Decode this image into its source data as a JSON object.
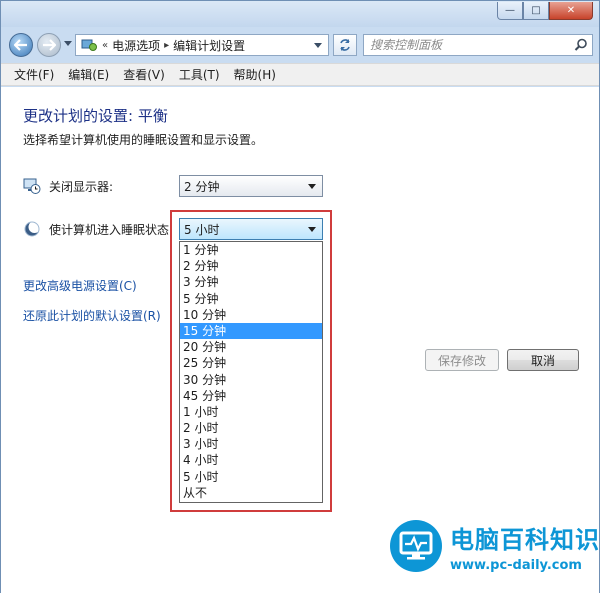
{
  "window": {
    "controls": {
      "minimize": "—",
      "maximize": "□",
      "close": "✕"
    }
  },
  "address_bar": {
    "chevron": "«",
    "breadcrumbs": [
      "电源选项",
      "编辑计划设置"
    ],
    "separator": "▸"
  },
  "search": {
    "placeholder": "搜索控制面板"
  },
  "menu": [
    "文件(F)",
    "编辑(E)",
    "查看(V)",
    "工具(T)",
    "帮助(H)"
  ],
  "page": {
    "title": "更改计划的设置: 平衡",
    "subtitle": "选择希望计算机使用的睡眠设置和显示设置。"
  },
  "settings": {
    "display_off": {
      "label": "关闭显示器:",
      "value": "2 分钟",
      "icon": "monitor-clock-icon"
    },
    "sleep": {
      "label": "使计算机进入睡眠状态:",
      "value": "5 小时",
      "icon": "moon-icon"
    }
  },
  "sleep_options": {
    "selected_index": 5,
    "items": [
      "1 分钟",
      "2 分钟",
      "3 分钟",
      "5 分钟",
      "10 分钟",
      "15 分钟",
      "20 分钟",
      "25 分钟",
      "30 分钟",
      "45 分钟",
      "1 小时",
      "2 小时",
      "3 小时",
      "4 小时",
      "5 小时",
      "从不"
    ]
  },
  "links": {
    "advanced": "更改高级电源设置(C)",
    "restore": "还原此计划的默认设置(R)"
  },
  "buttons": {
    "save": "保存修改",
    "cancel": "取消"
  },
  "watermark": {
    "title": "电脑百科知识",
    "url": "www.pc-daily.com"
  },
  "colors": {
    "highlight_box": "#d03c3c",
    "selection": "#3399ff",
    "link": "#1a51a4",
    "title": "#1e3287",
    "watermark": "#0d96d6"
  }
}
